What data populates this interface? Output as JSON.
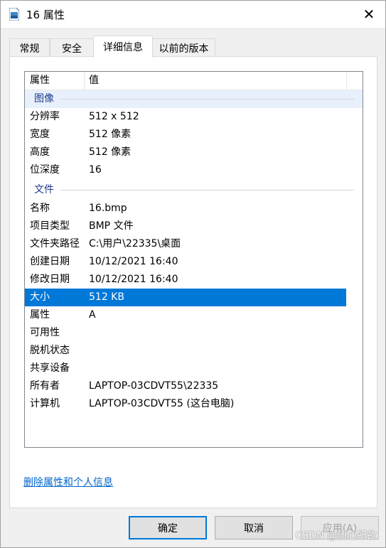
{
  "window": {
    "title": "16 属性",
    "close_glyph": "✕"
  },
  "tabs": [
    {
      "label": "常规"
    },
    {
      "label": "安全"
    },
    {
      "label": "详细信息"
    },
    {
      "label": "以前的版本"
    }
  ],
  "details": {
    "columns": [
      "属性",
      "值"
    ],
    "groups": [
      {
        "label": "图像",
        "rows": [
          {
            "name": "分辨率",
            "value": "512 x 512"
          },
          {
            "name": "宽度",
            "value": "512 像素"
          },
          {
            "name": "高度",
            "value": "512 像素"
          },
          {
            "name": "位深度",
            "value": "16"
          }
        ]
      },
      {
        "label": "文件",
        "rows": [
          {
            "name": "名称",
            "value": "16.bmp"
          },
          {
            "name": "项目类型",
            "value": "BMP 文件"
          },
          {
            "name": "文件夹路径",
            "value": "C:\\用户\\22335\\桌面"
          },
          {
            "name": "创建日期",
            "value": "10/12/2021 16:40"
          },
          {
            "name": "修改日期",
            "value": "10/12/2021 16:40"
          },
          {
            "name": "大小",
            "value": "512 KB"
          },
          {
            "name": "属性",
            "value": "A"
          },
          {
            "name": "可用性",
            "value": ""
          },
          {
            "name": "脱机状态",
            "value": ""
          },
          {
            "name": "共享设备",
            "value": ""
          },
          {
            "name": "所有者",
            "value": "LAPTOP-03CDVT55\\22335"
          },
          {
            "name": "计算机",
            "value": "LAPTOP-03CDVT55 (这台电脑)"
          }
        ]
      }
    ]
  },
  "remove_link": "删除属性和个人信息",
  "buttons": {
    "ok": "确定",
    "cancel": "取消",
    "apply": "应用(A)"
  },
  "watermark": "CSDN @随心所欲",
  "colors": {
    "accent": "#0078d7",
    "link": "#0066cc",
    "group": "#1e3b8a"
  }
}
